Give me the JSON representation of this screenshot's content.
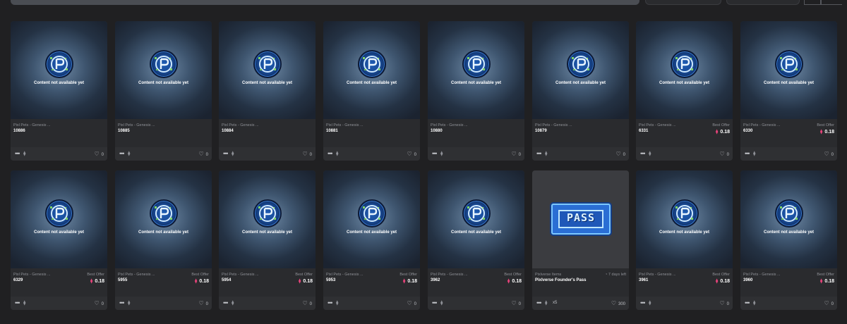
{
  "common": {
    "collection": "Pixl Pets - Genesis ...",
    "content_na": "Content not available yet",
    "best_offer_label": "Best Offer",
    "dots": "•••",
    "eth_glyph": "⧫",
    "heart_glyph": "♡",
    "currency_glyph": "⧫"
  },
  "cards": [
    {
      "collection": "Pixl Pets - Genesis ...",
      "token": "10886",
      "best_offer": "",
      "likes": "0"
    },
    {
      "collection": "Pixl Pets - Genesis ...",
      "token": "10885",
      "best_offer": "",
      "likes": "0"
    },
    {
      "collection": "Pixl Pets - Genesis ...",
      "token": "10884",
      "best_offer": "",
      "likes": "0"
    },
    {
      "collection": "Pixl Pets - Genesis ...",
      "token": "10881",
      "best_offer": "",
      "likes": "0"
    },
    {
      "collection": "Pixl Pets - Genesis ...",
      "token": "10880",
      "best_offer": "",
      "likes": "0"
    },
    {
      "collection": "Pixl Pets - Genesis ...",
      "token": "10879",
      "best_offer": "",
      "likes": "0"
    },
    {
      "collection": "Pixl Pets - Genesis ...",
      "token": "6331",
      "best_offer": "0.18",
      "likes": "0"
    },
    {
      "collection": "Pixl Pets - Genesis ...",
      "token": "6330",
      "best_offer": "0.18",
      "likes": "0"
    },
    {
      "collection": "Pixl Pets - Genesis ...",
      "token": "6329",
      "best_offer": "0.18",
      "likes": "0"
    },
    {
      "collection": "Pixl Pets - Genesis ...",
      "token": "5955",
      "best_offer": "0.18",
      "likes": "0"
    },
    {
      "collection": "Pixl Pets - Genesis ...",
      "token": "5954",
      "best_offer": "0.18",
      "likes": "0"
    },
    {
      "collection": "Pixl Pets - Genesis ...",
      "token": "5953",
      "best_offer": "0.18",
      "likes": "0"
    },
    {
      "collection": "Pixl Pets - Genesis ...",
      "token": "3962",
      "best_offer": "0.18",
      "likes": "0"
    },
    {
      "collection": "Pixlverse Items",
      "token": "Pixlverse Founder's Pass",
      "time_left": "7 days left",
      "quantity": "x5",
      "likes": "300",
      "image": "pass"
    },
    {
      "collection": "Pixl Pets - Genesis ...",
      "token": "3961",
      "best_offer": "0.18",
      "likes": "0"
    },
    {
      "collection": "Pixl Pets - Genesis ...",
      "token": "3960",
      "best_offer": "0.18",
      "likes": "0"
    }
  ],
  "pass_text": "PASS",
  "colors": {
    "accent": "#e8437a",
    "bg": "#202022",
    "card": "#2a2b2e"
  }
}
